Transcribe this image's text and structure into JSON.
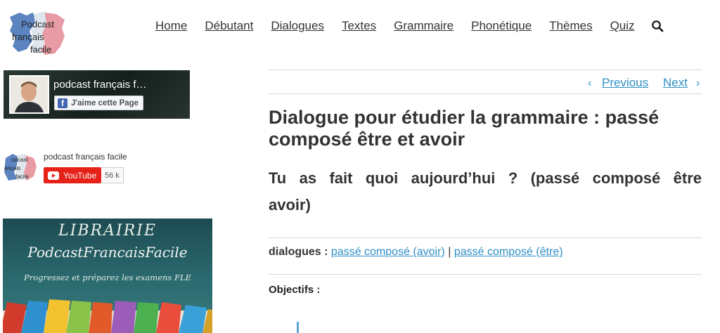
{
  "logo": {
    "line1": "Podcast",
    "line2": "français",
    "line3": "facile"
  },
  "nav": {
    "items": [
      "Home",
      "Débutant",
      "Dialogues",
      "Textes",
      "Grammaire",
      "Phonétique",
      "Thèmes",
      "Quiz"
    ],
    "search_icon": "search-icon"
  },
  "facebook": {
    "page_title": "podcast français f…",
    "like_label": "J'aime cette Page",
    "fb_icon": "f"
  },
  "youtube": {
    "logo_l1": "odcast",
    "logo_l2": "ançais",
    "logo_l3": "facile",
    "channel_name": "podcast français facile",
    "button_label": "YouTube",
    "subscriber_count": "56 k"
  },
  "banner": {
    "title": "LIBRAIRIE",
    "name": "PodcastFrancaisFacile",
    "tagline": "Progressez et préparez les examens FLE"
  },
  "post_nav": {
    "previous": "Previous",
    "next": "Next",
    "prev_chevron": "‹",
    "next_chevron": "›"
  },
  "article": {
    "title": "Dialogue pour étudier la grammaire : passé composé être et avoir",
    "subtitle": "Tu as fait quoi aujourd’hui ? (passé composé être avoir)",
    "tags_label": "dialogues :",
    "tag1": "passé composé (avoir)",
    "tag_separator": "|",
    "tag2": "passé composé (être)",
    "objectives_label": "Objectifs :"
  },
  "colors": {
    "link": "#2e8fc6",
    "youtube_red": "#e62117",
    "facebook_blue": "#4267b2"
  }
}
